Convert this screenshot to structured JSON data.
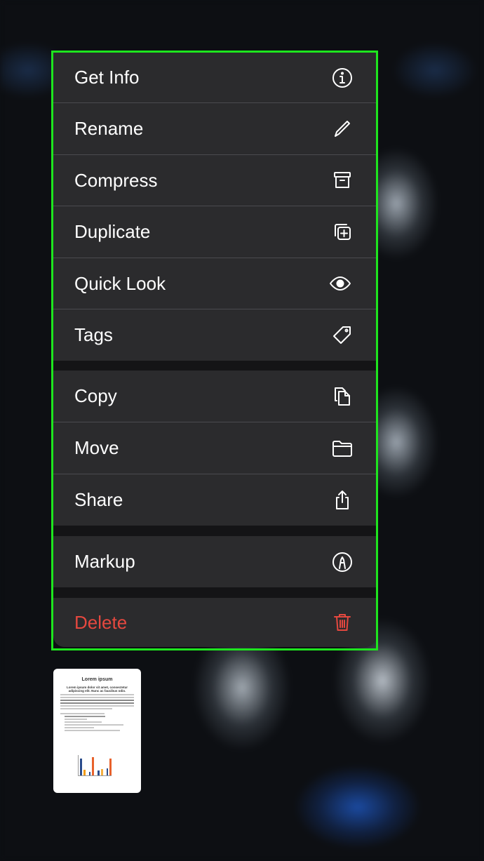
{
  "menu": {
    "items": [
      {
        "label": "Get Info",
        "icon": "info-circle-icon"
      },
      {
        "label": "Rename",
        "icon": "pencil-icon"
      },
      {
        "label": "Compress",
        "icon": "archive-box-icon"
      },
      {
        "label": "Duplicate",
        "icon": "duplicate-plus-icon"
      },
      {
        "label": "Quick Look",
        "icon": "eye-icon"
      },
      {
        "label": "Tags",
        "icon": "tag-icon"
      },
      {
        "label": "Copy",
        "icon": "copy-documents-icon"
      },
      {
        "label": "Move",
        "icon": "folder-icon"
      },
      {
        "label": "Share",
        "icon": "share-icon"
      },
      {
        "label": "Markup",
        "icon": "markup-pen-circle-icon"
      },
      {
        "label": "Delete",
        "icon": "trash-icon"
      }
    ],
    "danger_color": "#e5483f",
    "highlight_color": "#1ee51e"
  },
  "thumbnail": {
    "title": "Lorem ipsum",
    "subtitle": "Lorem ipsum dolor sit amet, consectetur adipiscing elit. Nunc ac faucibus odio."
  }
}
